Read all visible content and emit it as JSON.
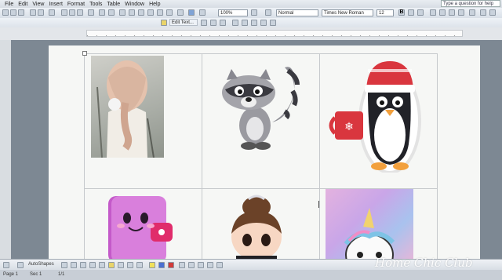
{
  "menu": [
    "File",
    "Edit",
    "View",
    "Insert",
    "Format",
    "Tools",
    "Table",
    "Window",
    "Help"
  ],
  "help_box": "Type a question for help",
  "toolbar": {
    "zoom": "100%",
    "style": "Normal",
    "font": "Times New Roman",
    "size": "12",
    "edit_text": "Edit Text..."
  },
  "drawing": {
    "autoshapes": "AutoShapes"
  },
  "status": {
    "page": "Page 1",
    "sec": "Sec 1",
    "pos": "1/1"
  },
  "watermark": "Home Chic Club",
  "cells": [
    {
      "name": "girl-braid-picture"
    },
    {
      "name": "raccoon-picture"
    },
    {
      "name": "penguin-mug-picture"
    },
    {
      "name": "pink-notebook-picture"
    },
    {
      "name": "audrey-doll-picture"
    },
    {
      "name": "unicorn-picture"
    }
  ]
}
